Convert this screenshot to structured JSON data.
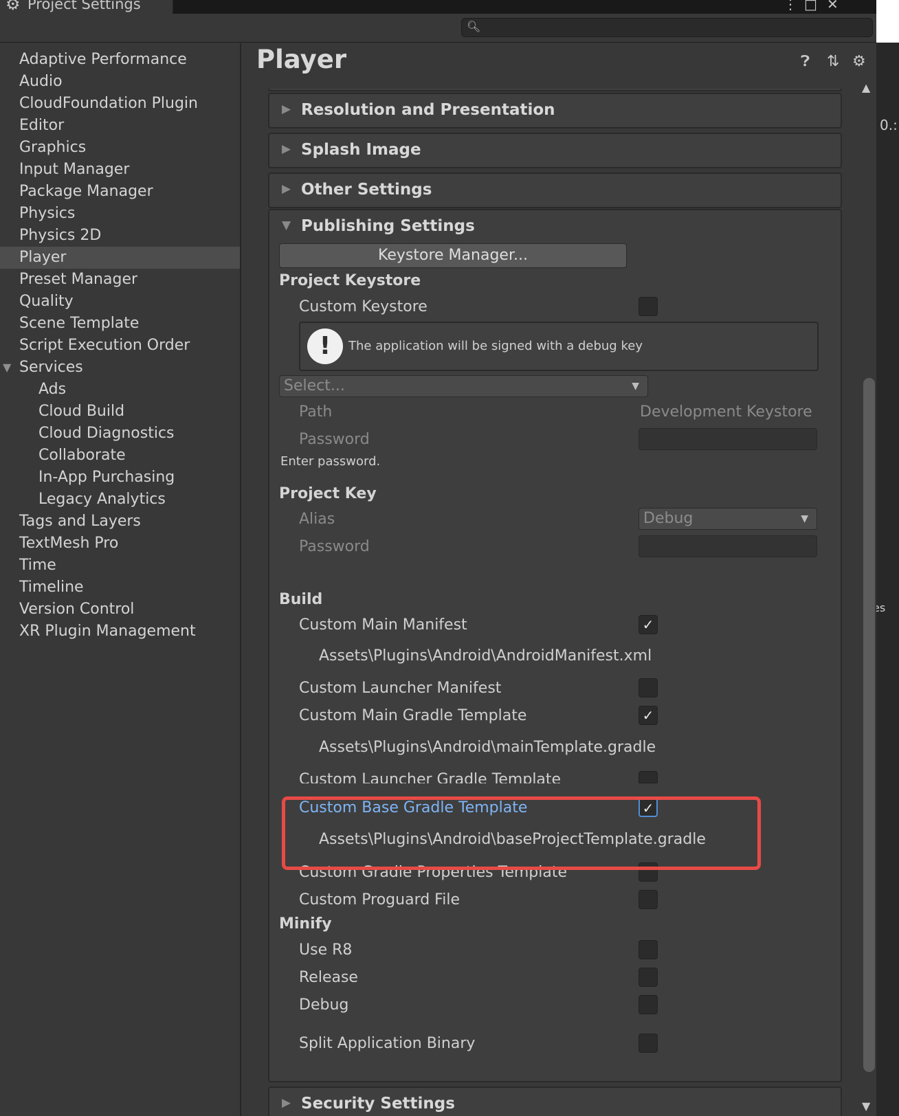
{
  "window": {
    "title": "Project Settings",
    "controls": [
      "⋮",
      "□",
      "✕"
    ]
  },
  "search": {
    "placeholder": "",
    "value": ""
  },
  "sidebar": {
    "items": [
      {
        "label": "Adaptive Performance",
        "indent": 0
      },
      {
        "label": "Audio",
        "indent": 0
      },
      {
        "label": "CloudFoundation Plugin",
        "indent": 0
      },
      {
        "label": "Editor",
        "indent": 0
      },
      {
        "label": "Graphics",
        "indent": 0
      },
      {
        "label": "Input Manager",
        "indent": 0
      },
      {
        "label": "Package Manager",
        "indent": 0
      },
      {
        "label": "Physics",
        "indent": 0
      },
      {
        "label": "Physics 2D",
        "indent": 0
      },
      {
        "label": "Player",
        "indent": 0,
        "selected": true
      },
      {
        "label": "Preset Manager",
        "indent": 0
      },
      {
        "label": "Quality",
        "indent": 0
      },
      {
        "label": "Scene Template",
        "indent": 0
      },
      {
        "label": "Script Execution Order",
        "indent": 0
      },
      {
        "label": "Services",
        "indent": 0,
        "expanded": true
      },
      {
        "label": "Ads",
        "indent": 1
      },
      {
        "label": "Cloud Build",
        "indent": 1
      },
      {
        "label": "Cloud Diagnostics",
        "indent": 1
      },
      {
        "label": "Collaborate",
        "indent": 1
      },
      {
        "label": "In-App Purchasing",
        "indent": 1
      },
      {
        "label": "Legacy Analytics",
        "indent": 1
      },
      {
        "label": "Tags and Layers",
        "indent": 0
      },
      {
        "label": "TextMesh Pro",
        "indent": 0
      },
      {
        "label": "Time",
        "indent": 0
      },
      {
        "label": "Timeline",
        "indent": 0
      },
      {
        "label": "Version Control",
        "indent": 0
      },
      {
        "label": "XR Plugin Management",
        "indent": 0
      }
    ]
  },
  "main": {
    "title": "Player",
    "icons": [
      "help-icon",
      "preset-icon",
      "settings-icon"
    ],
    "sections": {
      "resolution": "Resolution and Presentation",
      "splash": "Splash Image",
      "other": "Other Settings",
      "publishing": "Publishing Settings",
      "security": "Security Settings"
    },
    "publishing": {
      "keystore_button": "Keystore Manager...",
      "project_keystore": "Project Keystore",
      "custom_keystore": "Custom Keystore",
      "custom_keystore_checked": false,
      "help_message": "The application will be signed with a debug key",
      "select_placeholder": "Select...",
      "path_label": "Path",
      "path_value": "Development Keystore",
      "password_label": "Password",
      "enter_password": "Enter password.",
      "project_key": "Project Key",
      "alias_label": "Alias",
      "alias_value": "Debug",
      "key_password_label": "Password",
      "build_header": "Build",
      "custom_main_manifest": "Custom Main Manifest",
      "custom_main_manifest_checked": true,
      "main_manifest_path": "Assets\\Plugins\\Android\\AndroidManifest.xml",
      "custom_launcher_manifest": "Custom Launcher Manifest",
      "custom_launcher_manifest_checked": false,
      "custom_main_gradle": "Custom Main Gradle Template",
      "custom_main_gradle_checked": true,
      "main_gradle_path": "Assets\\Plugins\\Android\\mainTemplate.gradle",
      "custom_launcher_gradle": "Custom Launcher Gradle Template",
      "custom_launcher_gradle_checked": false,
      "custom_base_gradle": "Custom Base Gradle Template",
      "custom_base_gradle_checked": true,
      "base_gradle_path": "Assets\\Plugins\\Android\\baseProjectTemplate.gradle",
      "custom_gradle_properties": "Custom Gradle Properties Template",
      "custom_gradle_properties_checked": false,
      "custom_proguard": "Custom Proguard File",
      "custom_proguard_checked": false,
      "minify_header": "Minify",
      "use_r8": "Use R8",
      "release": "Release",
      "debug": "Debug",
      "split_binary": "Split Application Binary"
    }
  },
  "edge_fragments": {
    "top": "0.:",
    "bottom": "es"
  },
  "colors": {
    "highlight": "#e84a46",
    "selected_label": "#7fb4f4"
  }
}
